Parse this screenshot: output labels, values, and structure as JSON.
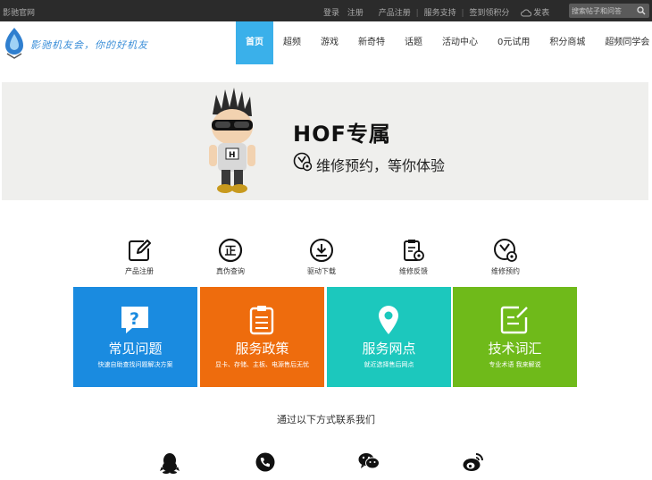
{
  "topbar": {
    "site_name": "影驰官网",
    "login": "登录",
    "register": "注册",
    "product_register": "产品注册",
    "service_support": "服务支持",
    "checkin_points": "签到领积分",
    "post": "发表",
    "search_placeholder": "搜索帖子和问答"
  },
  "header": {
    "slogan": "影驰机友会，你的好机友",
    "nav": [
      "首页",
      "超频",
      "游戏",
      "新奇特",
      "话题",
      "活动中心",
      "0元试用",
      "积分商城",
      "超频同学会"
    ]
  },
  "banner": {
    "title": "HOF专属",
    "subtitle": "维修预约，等你体验"
  },
  "quick_links": [
    {
      "label": "产品注册",
      "icon": "edit-icon"
    },
    {
      "label": "真伪查询",
      "icon": "authentic-icon"
    },
    {
      "label": "驱动下载",
      "icon": "download-icon"
    },
    {
      "label": "维修反馈",
      "icon": "clipboard-gear-icon"
    },
    {
      "label": "维修预约",
      "icon": "clock-gear-icon"
    }
  ],
  "tiles": [
    {
      "title": "常见问题",
      "subtitle": "快速自助查找问题解决方案",
      "color": "#1a8be0"
    },
    {
      "title": "服务政策",
      "subtitle": "显卡、存储、主板、电源售后无忧",
      "color": "#ee6c0d"
    },
    {
      "title": "服务网点",
      "subtitle": "就近选择售后网点",
      "color": "#1cc8bd"
    },
    {
      "title": "技术词汇",
      "subtitle": "专业术语 我来解说",
      "color": "#6fba1a"
    }
  ],
  "contact": {
    "title": "通过以下方式联系我们",
    "channels": [
      "qq-icon",
      "phone-icon",
      "wechat-icon",
      "weibo-icon"
    ]
  },
  "colors": {
    "topbar_bg": "#2b2b2b",
    "nav_active": "#3ab0ea",
    "banner_bg": "#efefed"
  }
}
